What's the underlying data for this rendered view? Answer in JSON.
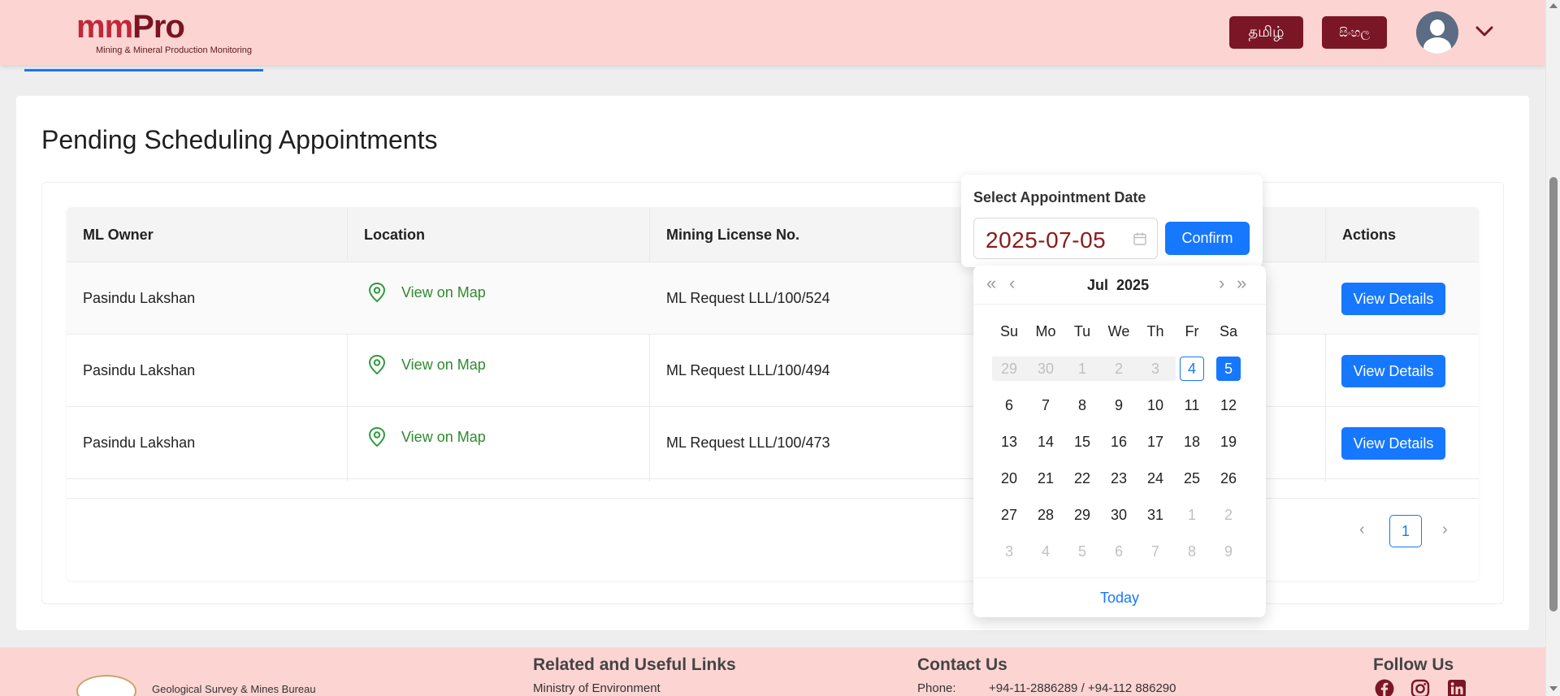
{
  "header": {
    "logo_main_a": "mm",
    "logo_main_b": "Pro",
    "logo_subtitle": "Mining & Mineral Production Monitoring",
    "lang_tamil": "தமிழ்",
    "lang_sinhala": "සිංහල",
    "avatar_icon": "user-avatar",
    "menu_icon": "chevron-down-icon"
  },
  "page": {
    "title": "Pending Scheduling Appointments"
  },
  "table": {
    "columns": [
      "ML Owner",
      "Location",
      "Mining License No.",
      "Actions"
    ],
    "rows": [
      {
        "owner": "Pasindu Lakshan",
        "location": "View on Map",
        "license": "ML Request LLL/100/524",
        "action": "View Details"
      },
      {
        "owner": "Pasindu Lakshan",
        "location": "View on Map",
        "license": "ML Request LLL/100/494",
        "action": "View Details"
      },
      {
        "owner": "Pasindu Lakshan",
        "location": "View on Map",
        "license": "ML Request LLL/100/473",
        "action": "View Details"
      }
    ]
  },
  "pagination": {
    "prev": "‹",
    "current": "1",
    "next": "›"
  },
  "appointment": {
    "label": "Select Appointment Date",
    "date_value": "2025-07-05",
    "confirm": "Confirm"
  },
  "calendar": {
    "nav_prev_year": "«",
    "nav_prev_month": "‹",
    "nav_next_month": "›",
    "nav_next_year": "»",
    "month": "Jul",
    "year": "2025",
    "weekdays": [
      "Su",
      "Mo",
      "Tu",
      "We",
      "Th",
      "Fr",
      "Sa"
    ],
    "weeks": [
      [
        "29",
        "30",
        "1",
        "2",
        "3",
        "4",
        "5"
      ],
      [
        "6",
        "7",
        "8",
        "9",
        "10",
        "11",
        "12"
      ],
      [
        "13",
        "14",
        "15",
        "16",
        "17",
        "18",
        "19"
      ],
      [
        "20",
        "21",
        "22",
        "23",
        "24",
        "25",
        "26"
      ],
      [
        "27",
        "28",
        "29",
        "30",
        "31",
        "1",
        "2"
      ],
      [
        "3",
        "4",
        "5",
        "6",
        "7",
        "8",
        "9"
      ]
    ],
    "today_button": "Today"
  },
  "footer": {
    "org": "Geological Survey & Mines Bureau",
    "links_heading": "Related and Useful Links",
    "link_1": "Ministry of Environment",
    "contact_heading": "Contact Us",
    "phone_label": "Phone:",
    "phone_value": "+94-11-2886289 / +94-112 886290",
    "follow_heading": "Follow Us"
  },
  "colors": {
    "header_bg": "#fcd5d3",
    "brand_dark": "#7b1626",
    "primary": "#1677ff",
    "map_green": "#2e8b2e"
  }
}
